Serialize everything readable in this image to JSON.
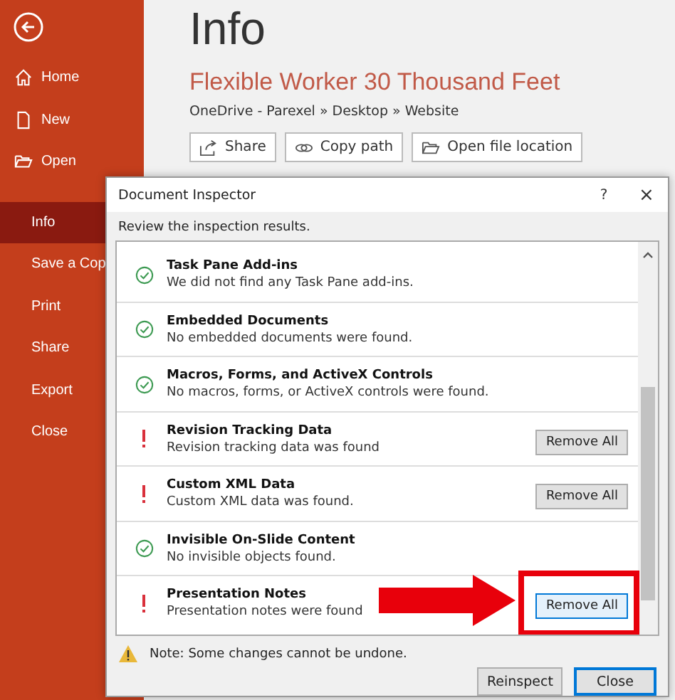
{
  "sidebar": {
    "items": [
      {
        "label": "Home",
        "selected": false
      },
      {
        "label": "New",
        "selected": false
      },
      {
        "label": "Open",
        "selected": false
      },
      {
        "label": "Info",
        "selected": true
      },
      {
        "label": "Save a Cop",
        "selected": false
      },
      {
        "label": "Print",
        "selected": false
      },
      {
        "label": "Share",
        "selected": false
      },
      {
        "label": "Export",
        "selected": false
      },
      {
        "label": "Close",
        "selected": false
      }
    ]
  },
  "page": {
    "heading": "Info",
    "file_title": "Flexible Worker 30 Thousand Feet",
    "path": "OneDrive - Parexel » Desktop » Website",
    "buttons": [
      {
        "label": "Share"
      },
      {
        "label": "Copy path"
      },
      {
        "label": "Open file location"
      }
    ]
  },
  "dialog": {
    "title": "Document Inspector",
    "help": "?",
    "close": "×",
    "instruction": "Review the inspection results.",
    "results": [
      {
        "name": "Task Pane Add-ins",
        "detail": "We did not find any Task Pane add-ins.",
        "kind": "passed"
      },
      {
        "name": "Embedded Documents",
        "detail": "No embedded documents were found.",
        "kind": "passed"
      },
      {
        "name": "Macros, Forms, and ActiveX Controls",
        "detail": "No macros, forms, or ActiveX controls were found.",
        "kind": "passed"
      },
      {
        "name": "Revision Tracking Data",
        "detail": "Revision tracking data was found",
        "kind": "found",
        "action": "Remove All"
      },
      {
        "name": "Custom XML Data",
        "detail": "Custom XML data was found.",
        "kind": "found",
        "action": "Remove All"
      },
      {
        "name": "Invisible On-Slide Content",
        "detail": "No invisible objects found.",
        "kind": "passed"
      },
      {
        "name": "Presentation Notes",
        "detail": "Presentation notes were found",
        "kind": "found",
        "action": "Remove All",
        "highlighted": true
      }
    ],
    "note": "Note: Some changes cannot be undone.",
    "buttons": [
      {
        "label": "Reinspect",
        "default": false
      },
      {
        "label": "Close",
        "default": true
      }
    ]
  }
}
